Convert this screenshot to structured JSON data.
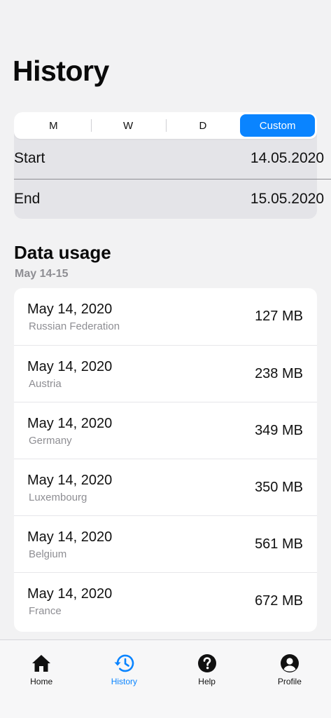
{
  "page": {
    "title": "History"
  },
  "period": {
    "segments": [
      {
        "label": "M",
        "active": false
      },
      {
        "label": "W",
        "active": false
      },
      {
        "label": "D",
        "active": false
      },
      {
        "label": "Custom",
        "active": true
      }
    ],
    "start_label": "Start",
    "start_value": "14.05.2020",
    "end_label": "End",
    "end_value": "15.05.2020"
  },
  "data_usage": {
    "title": "Data usage",
    "subtitle": "May 14-15",
    "items": [
      {
        "date": "May 14, 2020",
        "country": "Russian Federation",
        "amount": "127 MB"
      },
      {
        "date": "May 14, 2020",
        "country": "Austria",
        "amount": "238 MB"
      },
      {
        "date": "May 14, 2020",
        "country": "Germany",
        "amount": "349 MB"
      },
      {
        "date": "May 14, 2020",
        "country": "Luxembourg",
        "amount": "350 MB"
      },
      {
        "date": "May 14, 2020",
        "country": "Belgium",
        "amount": "561 MB"
      },
      {
        "date": "May 14, 2020",
        "country": "France",
        "amount": "672 MB"
      }
    ]
  },
  "tab_bar": {
    "items": [
      {
        "label": "Home",
        "icon": "home-icon",
        "active": false
      },
      {
        "label": "History",
        "icon": "history-icon",
        "active": true
      },
      {
        "label": "Help",
        "icon": "help-icon",
        "active": false
      },
      {
        "label": "Profile",
        "icon": "profile-icon",
        "active": false
      }
    ]
  },
  "colors": {
    "accent": "#0a84ff",
    "background": "#f2f2f3",
    "secondary_text": "#8e8e93"
  }
}
